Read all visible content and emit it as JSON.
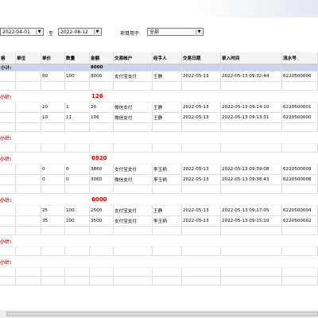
{
  "filter": {
    "start_date": "2022-04-01",
    "to_label": "至",
    "end_date": "2022-08-12",
    "purpose_label": "项目用于:",
    "purpose_value": "全部",
    "arrow": "▼"
  },
  "headers": [
    "格",
    "单位",
    "单价",
    "数量",
    "金额",
    "交易帐户",
    "经手人",
    "交易日期",
    "录入时间",
    "流水号"
  ],
  "subtotal_label": "小计:",
  "rows": [
    {
      "type": "subtotal_top",
      "label": "小计:",
      "amount": "8000"
    },
    {
      "type": "data",
      "cells": [
        "",
        "",
        "80",
        "100",
        "8000",
        "支付宝支付",
        "王静",
        "2022-05-13",
        "2022-05-13 09:32:44",
        "6220500006"
      ]
    },
    {
      "type": "blank"
    },
    {
      "type": "subtotal",
      "label": "小计:",
      "amount": "126"
    },
    {
      "type": "data",
      "cells": [
        "",
        "",
        "20",
        "1",
        "20",
        "微信支付",
        "王静",
        "2022-05-13",
        "2022-05-13 09:14:10",
        "6220500001"
      ]
    },
    {
      "type": "data",
      "cells": [
        "",
        "",
        "10",
        "11",
        "106",
        "微信支付",
        "王静",
        "2022-05-13",
        "2022-05-13 09:13:31",
        "6220500000"
      ]
    },
    {
      "type": "blank"
    },
    {
      "type": "subtotal",
      "label": "小计:",
      "amount": ""
    },
    {
      "type": "blank"
    },
    {
      "type": "subtotal",
      "label": "小计:",
      "amount": "6920"
    },
    {
      "type": "data",
      "cells": [
        "",
        "",
        "0",
        "0",
        "3860",
        "支付宝支付",
        "李玉柄",
        "2022-05-13",
        "2022-05-13 09:39:08",
        "6220500009"
      ]
    },
    {
      "type": "data",
      "cells": [
        "",
        "",
        "0",
        "0",
        "3060",
        "微信支付",
        "李玉柄",
        "2022-05-13",
        "2022-05-13 09:38:43",
        "6220500008"
      ]
    },
    {
      "type": "blank"
    },
    {
      "type": "subtotal",
      "label": "小计:",
      "amount": "6000"
    },
    {
      "type": "data",
      "cells": [
        "",
        "",
        "25",
        "100",
        "2500",
        "支付宝支付",
        "王静",
        "2022-05-13",
        "2022-05-13 09:17:05",
        "6220500004"
      ]
    },
    {
      "type": "data",
      "cells": [
        "",
        "",
        "35",
        "100",
        "3500",
        "支付宝支付",
        "李玉柄",
        "2022-05-13",
        "2022-05-13 09:15:10",
        "6220500002"
      ]
    },
    {
      "type": "blank"
    },
    {
      "type": "subtotal",
      "label": "小计:",
      "amount": ""
    },
    {
      "type": "blank"
    },
    {
      "type": "subtotal",
      "label": "小计:",
      "amount": ""
    },
    {
      "type": "blank"
    },
    {
      "type": "blank"
    }
  ]
}
